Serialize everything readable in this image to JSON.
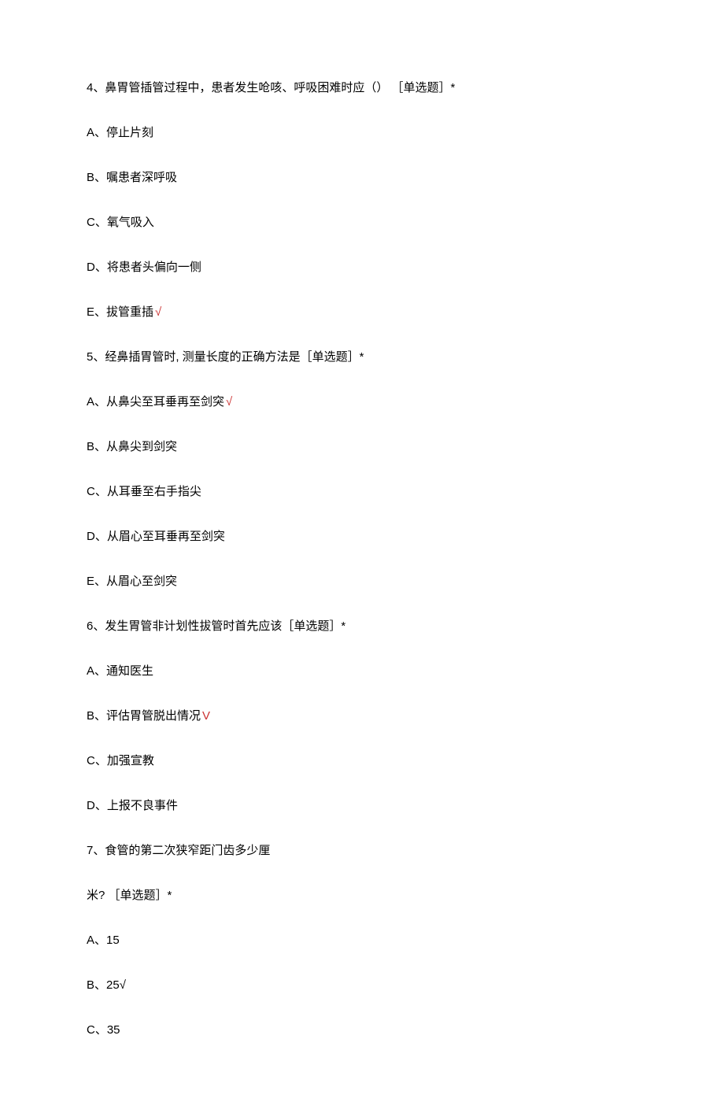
{
  "questions": [
    {
      "stem": "4、鼻胃管插管过程中，患者发生呛咳、呼吸困难时应（） ［单选题］*",
      "options": [
        {
          "text": "A、停止片刻",
          "correct": false
        },
        {
          "text": "B、嘱患者深呼吸",
          "correct": false
        },
        {
          "text": "C、氧气吸入",
          "correct": false
        },
        {
          "text": "D、将患者头偏向一侧",
          "correct": false
        },
        {
          "text": "E、拔管重插",
          "correct": true,
          "mark": "√"
        }
      ]
    },
    {
      "stem": "5、经鼻插胃管时, 测量长度的正确方法是［单选题］*",
      "options": [
        {
          "text": "A、从鼻尖至耳垂再至剑突",
          "correct": true,
          "mark": "√"
        },
        {
          "text": "B、从鼻尖到剑突",
          "correct": false
        },
        {
          "text": "C、从耳垂至右手指尖",
          "correct": false
        },
        {
          "text": "D、从眉心至耳垂再至剑突",
          "correct": false
        },
        {
          "text": "E、从眉心至剑突",
          "correct": false
        }
      ]
    },
    {
      "stem": "6、发生胃管非计划性拔管时首先应该［单选题］*",
      "options": [
        {
          "text": "A、通知医生",
          "correct": false
        },
        {
          "text": "B、评估胃管脱出情况",
          "correct": true,
          "mark": "V"
        },
        {
          "text": "C、加强宣教",
          "correct": false
        },
        {
          "text": "D、上报不良事件",
          "correct": false
        }
      ]
    },
    {
      "stem_lines": [
        "7、食管的第二次狭窄距门齿多少厘",
        "米? ［单选题］*"
      ],
      "options": [
        {
          "text": "A、15",
          "correct": false
        },
        {
          "text": "B、25√",
          "correct": false
        },
        {
          "text": "C、35",
          "correct": false
        }
      ]
    }
  ]
}
